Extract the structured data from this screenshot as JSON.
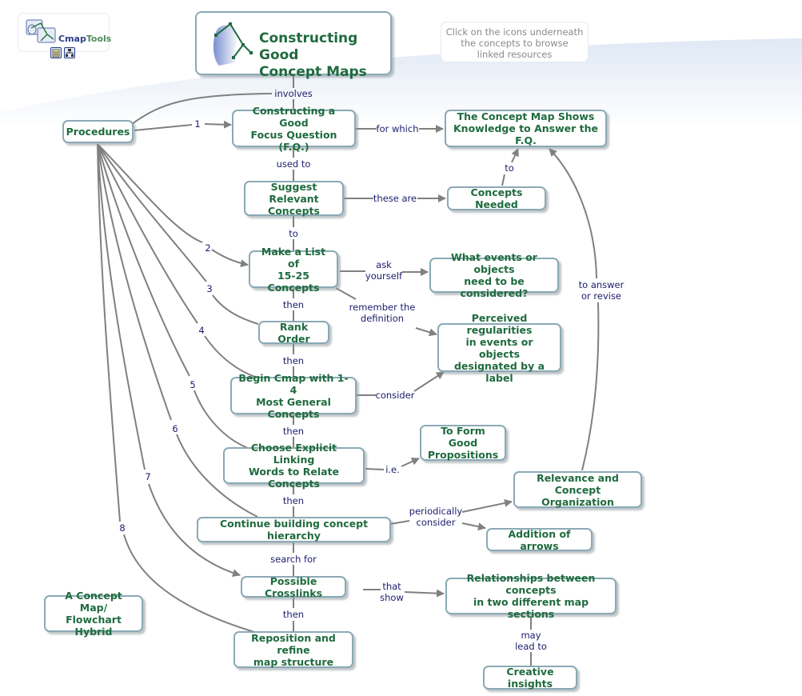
{
  "logo": {
    "text_a": "Cmap",
    "text_b": "Tools",
    "icons": [
      "document-resource-icon",
      "concept-map-resource-icon"
    ]
  },
  "title": {
    "text": "Constructing Good\nConcept Maps",
    "icon": "head-with-concept-map-icon"
  },
  "hint": {
    "text": "Click on the icons underneath\nthe concepts to browse\nlinked resources"
  },
  "colors": {
    "node_text": "#1f6b3e",
    "node_border": "#8aa9b5",
    "link_text": "#1c1c6e",
    "line": "#808080",
    "background_band": "#e4ecf6"
  },
  "nodes": {
    "procedures": "Procedures",
    "focus_question": "Constructing a Good\nFocus Question (F.Q.)",
    "map_shows": "The Concept Map Shows\nKnowledge to Answer the F.Q.",
    "suggest": "Suggest Relevant\nConcepts",
    "concepts_needed": "Concepts Needed",
    "make_list": "Make a List of\n15-25 Concepts",
    "what_events": "What events or objects\nneed to be considered?",
    "rank_order": "Rank Order",
    "perceived": "Perceived regularities\nin events or objects\ndesignated by a label",
    "begin_cmap": "Begin Cmap with 1-4\nMost General Concepts",
    "form_props": "To Form Good\nPropositions",
    "choose_words": "Choose Explicit Linking\nWords to Relate Concepts",
    "relevance": "Relevance and Concept\nOrganization",
    "continue": "Continue building concept hierarchy",
    "arrows": "Addition of arrows",
    "crosslinks": "Possible Crosslinks",
    "relationships": "Relationships between concepts\nin two different map sections",
    "hybrid": "A Concept Map/\nFlowchart Hybrid",
    "reposition": "Reposition and refine\nmap structure",
    "insights": "Creative insights"
  },
  "links": {
    "involves": "involves",
    "for_which": "for which",
    "used_to": "used to",
    "these_are": "these are",
    "to1": "to",
    "to2": "to",
    "ask_yourself": "ask\nyourself",
    "remember": "remember the\ndefinition",
    "then1": "then",
    "then2": "then",
    "consider": "consider",
    "then3": "then",
    "ie": "i.e.",
    "then4": "then",
    "periodically": "periodically\nconsider",
    "to_answer": "to answer\nor revise",
    "search_for": "search for",
    "that_show": "that\nshow",
    "then5": "then",
    "may_lead": "may\nlead to"
  },
  "step_numbers": [
    "1",
    "2",
    "3",
    "4",
    "5",
    "6",
    "7",
    "8"
  ]
}
